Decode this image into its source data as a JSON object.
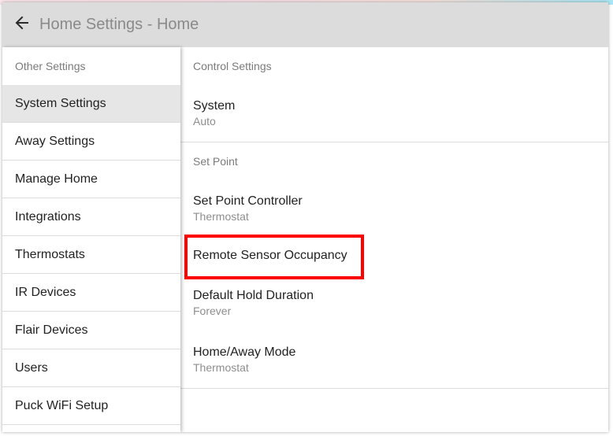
{
  "header": {
    "title": "Home Settings - Home",
    "back_icon": "arrow-left-icon"
  },
  "sidebar": {
    "header": "Other Settings",
    "items": [
      {
        "label": "System Settings",
        "active": true
      },
      {
        "label": "Away Settings"
      },
      {
        "label": "Manage Home"
      },
      {
        "label": "Integrations"
      },
      {
        "label": "Thermostats"
      },
      {
        "label": "IR Devices"
      },
      {
        "label": "Flair Devices"
      },
      {
        "label": "Users"
      },
      {
        "label": "Puck WiFi Setup"
      }
    ]
  },
  "content": {
    "control_section": {
      "header": "Control Settings",
      "system": {
        "label": "System",
        "value": "Auto"
      }
    },
    "setpoint_section": {
      "header": "Set Point",
      "controller": {
        "label": "Set Point Controller",
        "value": "Thermostat"
      },
      "remote_sensor": {
        "label": "Remote Sensor Occupancy"
      },
      "hold_duration": {
        "label": "Default Hold Duration",
        "value": "Forever"
      },
      "home_away": {
        "label": "Home/Away Mode",
        "value": "Thermostat"
      }
    }
  },
  "colors": {
    "header_bg": "#dcdcdc",
    "active_item_bg": "#e6e6e6",
    "highlight": "#ff0000"
  }
}
